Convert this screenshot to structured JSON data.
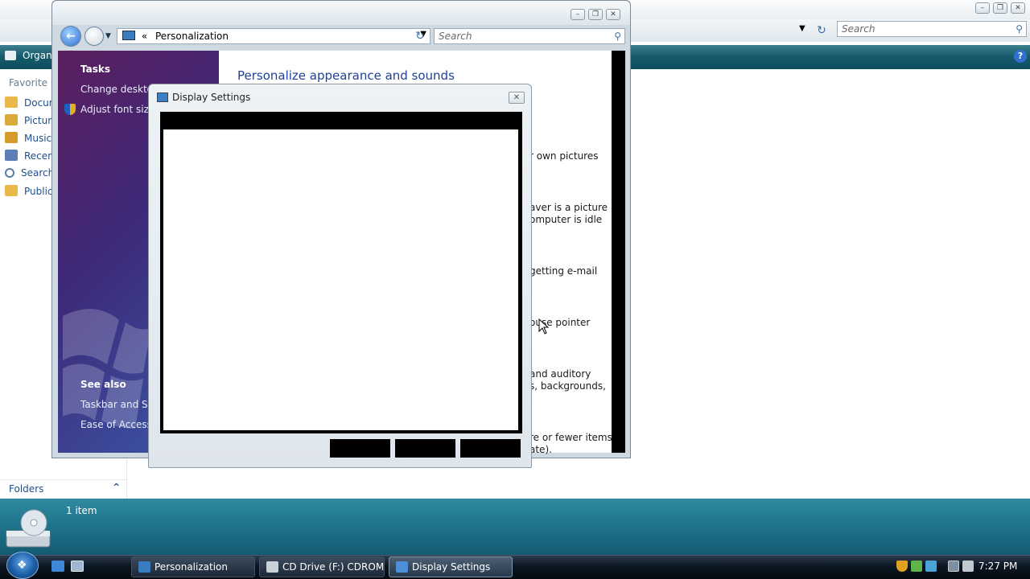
{
  "background_window": {
    "search_placeholder": "Search",
    "toolbar_organize": "Organ",
    "help_glyph": "?",
    "nav_header": "Favorite Li",
    "nav_links": [
      "Docum",
      "Picture",
      "Music",
      "Recent",
      "Search",
      "Public"
    ],
    "folders_label": "Folders",
    "folders_chevron": "^",
    "item_count": "1 item",
    "minimize": "–",
    "restore": "❐",
    "close": "✕"
  },
  "personalization": {
    "address_path": "Personalization",
    "address_chevrons": "«",
    "search_placeholder": "Search",
    "sidebar": {
      "tasks_header": "Tasks",
      "tasks": [
        "Change desktop",
        "Adjust font size"
      ],
      "see_also_header": "See also",
      "see_also": [
        "Taskbar and Sta",
        "Ease of Access"
      ]
    },
    "heading": "Personalize appearance and sounds",
    "content_fragments": [
      "r own pictures",
      "aver is a picture",
      "omputer is idle",
      "getting e-mail",
      "ouse pointer",
      "and auditory",
      "s, backgrounds,",
      "re or fewer items",
      "ate)."
    ],
    "minimize": "–",
    "restore": "❐",
    "close": "✕",
    "back_glyph": "←",
    "refresh_glyph": "↻"
  },
  "display_settings": {
    "title": "Display Settings",
    "close": "✕"
  },
  "taskbar": {
    "tasks": [
      "Personalization",
      "CD Drive (F:) CDROM",
      "Display Settings"
    ],
    "clock": "7:27 PM"
  }
}
